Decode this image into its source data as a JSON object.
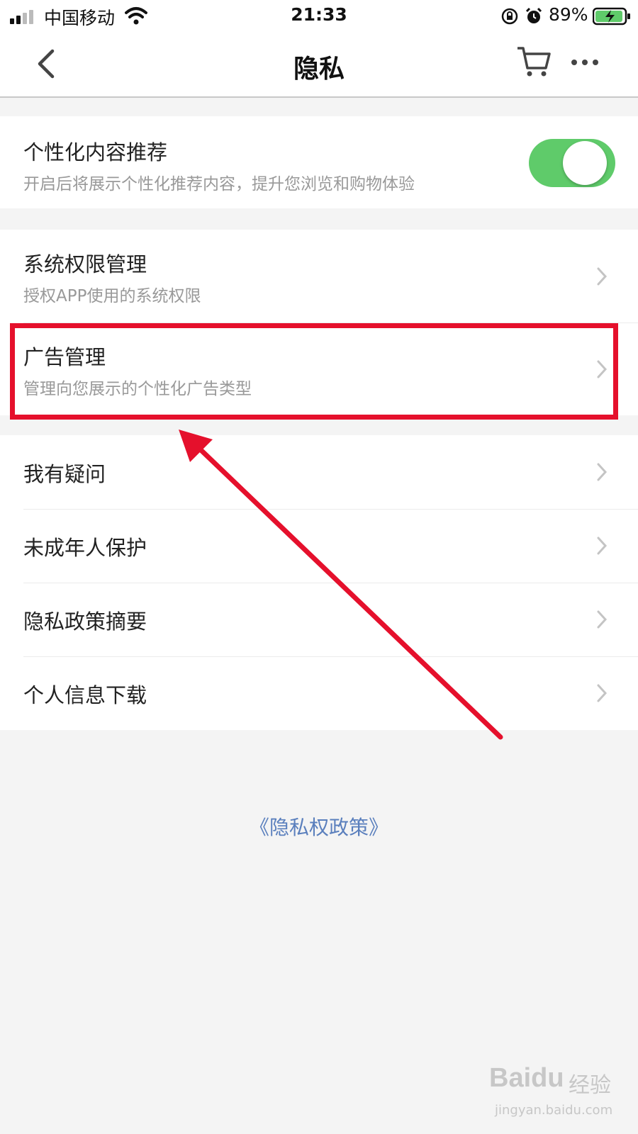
{
  "status_bar": {
    "carrier": "中国移动",
    "time": "21:33",
    "battery_percent": "89%"
  },
  "nav": {
    "title": "隐私"
  },
  "personalized": {
    "title": "个性化内容推荐",
    "description": "开启后将展示个性化推荐内容，提升您浏览和购物体验",
    "enabled": true
  },
  "permission_items": [
    {
      "title": "系统权限管理",
      "subtitle": "授权APP使用的系统权限"
    },
    {
      "title": "广告管理",
      "subtitle": "管理向您展示的个性化广告类型"
    }
  ],
  "menu_items": [
    {
      "title": "我有疑问"
    },
    {
      "title": "未成年人保护"
    },
    {
      "title": "隐私政策摘要"
    },
    {
      "title": "个人信息下载"
    }
  ],
  "policy_link": "《隐私权政策》",
  "watermark": {
    "logo": "Baidu",
    "text": "经验",
    "url": "jingyan.baidu.com"
  },
  "colors": {
    "toggle_on": "#5fcb6a",
    "highlight": "#e5102c",
    "link": "#5a7fbd"
  }
}
